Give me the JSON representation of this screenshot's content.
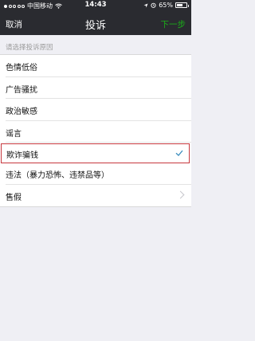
{
  "status": {
    "carrier": "中国移动",
    "time": "14:43",
    "battery": "65%",
    "battery_level": 0.65
  },
  "nav": {
    "cancel_label": "取消",
    "title": "投诉",
    "next_label": "下一步"
  },
  "section_header": "请选择投诉原因",
  "reasons": [
    {
      "label": "色情低俗"
    },
    {
      "label": "广告骚扰"
    },
    {
      "label": "政治敏感"
    },
    {
      "label": "谣言"
    },
    {
      "label": "欺诈骗钱",
      "selected": true
    },
    {
      "label": "违法（暴力恐怖、违禁品等）"
    },
    {
      "label": "售假"
    }
  ],
  "colors": {
    "accent_green": "#1aad19",
    "selection_outline": "#c7383e",
    "checkmark": "#3b8dbd"
  }
}
